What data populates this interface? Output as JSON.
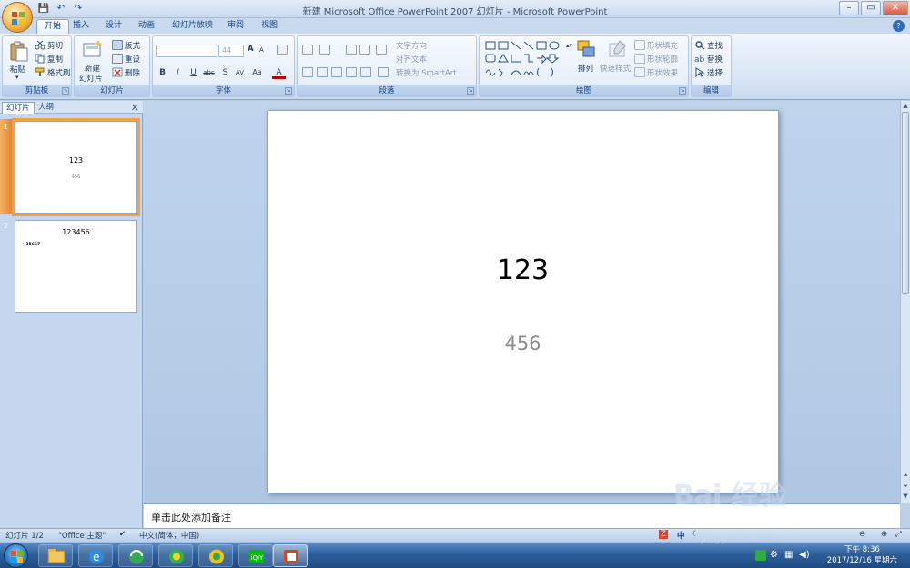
{
  "window": {
    "title": "新建 Microsoft Office PowerPoint 2007 幻灯片 - Microsoft PowerPoint",
    "minimize": "–",
    "maximize": "▭",
    "close": "✕"
  },
  "qat": {
    "save": "💾",
    "undo": "↶",
    "redo": "↷"
  },
  "ribbon_tabs": [
    "开始",
    "插入",
    "设计",
    "动画",
    "幻灯片放映",
    "审阅",
    "视图"
  ],
  "help": "?",
  "clipboard": {
    "paste": "粘贴",
    "cut": "剪切",
    "copy": "复制",
    "format_painter": "格式刷",
    "label": "剪贴板"
  },
  "slides_group": {
    "new_slide": "新建",
    "new_slide_2": "幻灯片",
    "layout": "版式",
    "reset": "重设",
    "delete": "删除",
    "label": "幻灯片"
  },
  "font_group": {
    "font_size": "44",
    "bold": "B",
    "italic": "I",
    "underline": "U",
    "strike": "abc",
    "shadow": "S",
    "spacing": "AV",
    "case": "Aa",
    "color": "A",
    "grow": "A",
    "shrink": "A",
    "label": "字体"
  },
  "paragraph_group": {
    "text_direction": "文字方向",
    "align_text": "对齐文本",
    "smartart": "转换为 SmartArt",
    "label": "段落"
  },
  "drawing_group": {
    "arrange": "排列",
    "quick_styles": "快速样式",
    "shape_fill": "形状填充",
    "shape_outline": "形状轮廓",
    "shape_effects": "形状效果",
    "label": "绘图"
  },
  "editing_group": {
    "find": "查找",
    "replace": "替换",
    "select": "选择",
    "label": "编辑"
  },
  "panel_tabs": {
    "slides": "幻灯片",
    "outline": "大纲",
    "close": "✕"
  },
  "thumbnails": [
    {
      "num": "1",
      "title": "123",
      "sub": "456"
    },
    {
      "num": "2",
      "title": "123456",
      "bullet": "• 35667"
    }
  ],
  "slide": {
    "title": "123",
    "subtitle": "456"
  },
  "notes": {
    "placeholder": "单击此处添加备注"
  },
  "status": {
    "slide_count": "幻灯片 1/2",
    "theme": "\"Office 主题\"",
    "language": "中文(简体，中国)"
  },
  "clock": {
    "time": "下午 8:36",
    "date": "2017/12/16 星期六"
  },
  "ime": {
    "lang": "中"
  },
  "watermark": {
    "main": "Bai 经验",
    "sub": "jingyan.baidu.com"
  },
  "colors": {
    "ribbon": "#dbe7f6",
    "accent": "#15428b",
    "selected_thumb": "#f0a04a",
    "taskbar": "#2e5f9a"
  }
}
